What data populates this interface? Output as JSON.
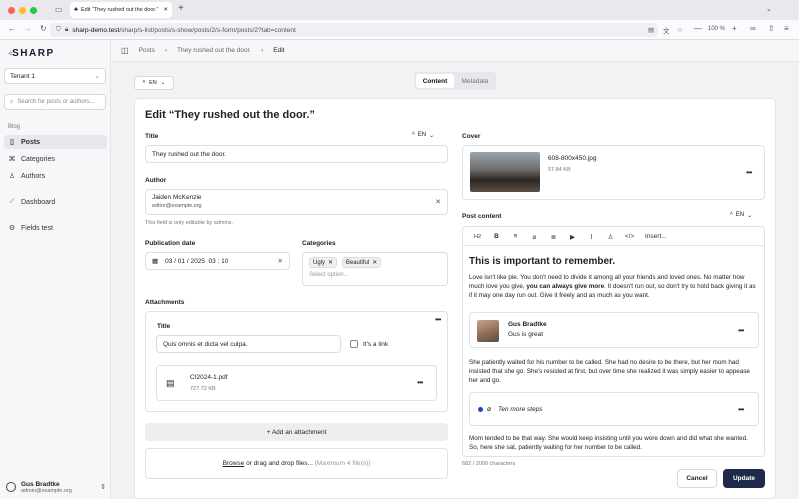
{
  "browser": {
    "tab_title": "Edit “They rushed out the door.”",
    "url_host": "sharp-demo.test",
    "url_path": "/sharp/s-list/posts/s-show/posts/2/s-form/posts/2?tab=content",
    "zoom": "100 %"
  },
  "sidebar": {
    "logo": "SHARP",
    "tenant": "Tenant 1",
    "search_placeholder": "Search for posts or authors...",
    "section_label": "Blog",
    "items": [
      {
        "label": "Posts",
        "icon": "document-icon"
      },
      {
        "label": "Categories",
        "icon": "hierarchy-icon"
      },
      {
        "label": "Authors",
        "icon": "user-icon"
      },
      {
        "label": "Dashboard",
        "icon": "chart-icon"
      },
      {
        "label": "Fields test",
        "icon": "gear-icon"
      }
    ],
    "user": {
      "name": "Gus Bradtke",
      "email": "admin@example.org"
    }
  },
  "breadcrumb": [
    "Posts",
    "They rushed out the door.",
    "Edit"
  ],
  "locale": "EN",
  "tabs": [
    "Content",
    "Metadata"
  ],
  "form": {
    "title": "Edit “They rushed out the door.”",
    "title_label": "Title",
    "title_value": "They rushed out the door.",
    "author_label": "Author",
    "author_name": "Jaiden McKenzie",
    "author_email": "editor@example.org",
    "author_help": "This field is only editable by admins.",
    "publication_label": "Publication date",
    "publication_value": "03 / 01 / 2025  03 : 10",
    "categories_label": "Categories",
    "categories": [
      "Ugly",
      "Beautiful"
    ],
    "categories_placeholder": "Select option...",
    "attachments_label": "Attachments",
    "attachment": {
      "title_label": "Title",
      "title_value": "Quis omnis et dicta vel culpa.",
      "link_label": "It's a link",
      "file_name": "CI2024-1.pdf",
      "file_size": "727.72 KB"
    },
    "add_attachment": "+ Add an attachment",
    "browse_link": "Browse",
    "browse_text": " or drag and drop files...",
    "browse_max": " (Maximum 4 file(s))",
    "cover_label": "Cover",
    "cover": {
      "file_name": "608-800x450.jpg",
      "file_size": "57.84 KB"
    },
    "content_label": "Post content",
    "toolbar": [
      "H2",
      "B",
      "≡",
      "⌀",
      "≣",
      "▶",
      "⌇",
      "♙",
      "</>"
    ],
    "toolbar_insert": "Insert...",
    "heading": "This is important to remember.",
    "para1_a": "Love isn't like pie. You don't need to divide it among all your friends and loved ones. No matter how much love you give, ",
    "para1_b": "you can always give more",
    "para1_c": ". It doesn't run out, so don't try to hold back giving it as if it may one day run out. Give it freely and as much as you want.",
    "embed_name": "Gus Bradtke",
    "embed_text": "Gus is great",
    "para2": "She patiently waited for his number to be called. She had no desire to be there, but her mom had insisted that she go. She's resisted at first, but over time she realized it was simply easier to appease her and go.",
    "steps": "Ten more steps",
    "para3": "Mom tended to be that way. She would keep insisting until you wore down and did what she wanted. So, here she sat, patiently waiting for her number to be called.",
    "char_count": "682 / 2000 characters",
    "cancel": "Cancel",
    "update": "Update"
  },
  "colors": {
    "primary": "#1e2a4a",
    "accent": "#2244cc"
  }
}
